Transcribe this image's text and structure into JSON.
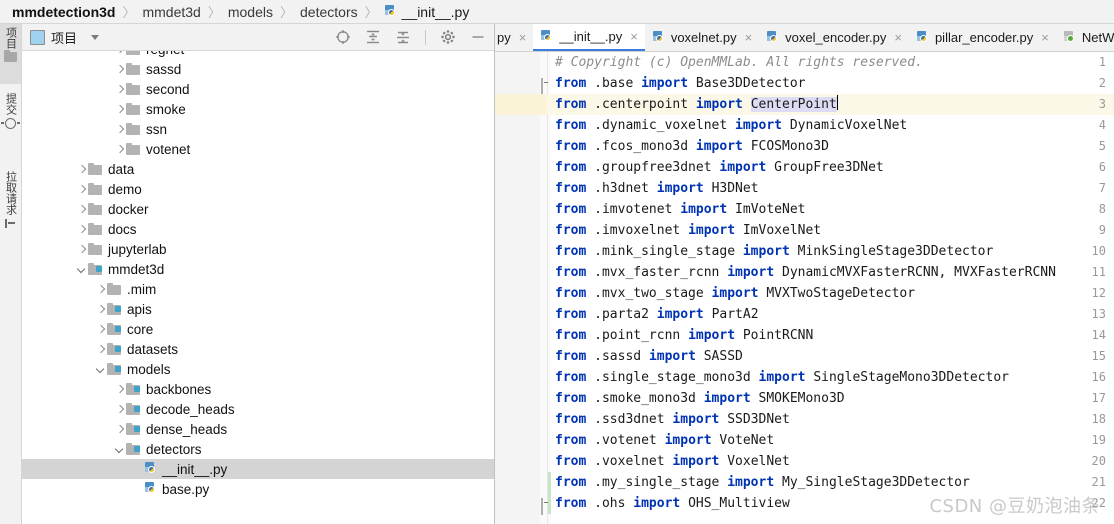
{
  "breadcrumb": {
    "items": [
      "mmdetection3d",
      "mmdet3d",
      "models",
      "detectors"
    ],
    "file": "__init__.py",
    "separator": "〉"
  },
  "toolstrip": {
    "items": [
      {
        "label": "项目",
        "icon": "folder-icon",
        "active": true
      },
      {
        "label": "提交",
        "icon": "commit-icon",
        "active": false
      },
      {
        "label": "拉取请求",
        "icon": "pull-request-icon",
        "active": false
      }
    ]
  },
  "project_panel": {
    "title": "项目",
    "tools": [
      {
        "name": "select-opened-file-icon",
        "label": "Select Opened File"
      },
      {
        "name": "expand-all-icon",
        "label": "Expand All"
      },
      {
        "name": "collapse-all-icon",
        "label": "Collapse All"
      },
      {
        "name": "settings-gear-icon",
        "label": "Settings"
      },
      {
        "name": "hide-panel-icon",
        "label": "Hide"
      }
    ],
    "tree": [
      {
        "label": "regnet",
        "depth": 3,
        "arrow": "right",
        "type": "folder",
        "selected": false
      },
      {
        "label": "sassd",
        "depth": 3,
        "arrow": "right",
        "type": "folder",
        "selected": false
      },
      {
        "label": "second",
        "depth": 3,
        "arrow": "right",
        "type": "folder",
        "selected": false
      },
      {
        "label": "smoke",
        "depth": 3,
        "arrow": "right",
        "type": "folder",
        "selected": false
      },
      {
        "label": "ssn",
        "depth": 3,
        "arrow": "right",
        "type": "folder",
        "selected": false
      },
      {
        "label": "votenet",
        "depth": 3,
        "arrow": "right",
        "type": "folder",
        "selected": false
      },
      {
        "label": "data",
        "depth": 1,
        "arrow": "right",
        "type": "folder",
        "selected": false
      },
      {
        "label": "demo",
        "depth": 1,
        "arrow": "right",
        "type": "folder",
        "selected": false
      },
      {
        "label": "docker",
        "depth": 1,
        "arrow": "right",
        "type": "folder",
        "selected": false
      },
      {
        "label": "docs",
        "depth": 1,
        "arrow": "right",
        "type": "folder",
        "selected": false
      },
      {
        "label": "jupyterlab",
        "depth": 1,
        "arrow": "right",
        "type": "folder",
        "selected": false
      },
      {
        "label": "mmdet3d",
        "depth": 1,
        "arrow": "down",
        "type": "folder-src",
        "selected": false
      },
      {
        "label": ".mim",
        "depth": 2,
        "arrow": "right",
        "type": "folder",
        "selected": false
      },
      {
        "label": "apis",
        "depth": 2,
        "arrow": "right",
        "type": "folder-src",
        "selected": false
      },
      {
        "label": "core",
        "depth": 2,
        "arrow": "right",
        "type": "folder-src",
        "selected": false
      },
      {
        "label": "datasets",
        "depth": 2,
        "arrow": "right",
        "type": "folder-src",
        "selected": false
      },
      {
        "label": "models",
        "depth": 2,
        "arrow": "down",
        "type": "folder-src",
        "selected": false
      },
      {
        "label": "backbones",
        "depth": 3,
        "arrow": "right",
        "type": "folder-src",
        "selected": false
      },
      {
        "label": "decode_heads",
        "depth": 3,
        "arrow": "right",
        "type": "folder-src",
        "selected": false
      },
      {
        "label": "dense_heads",
        "depth": 3,
        "arrow": "right",
        "type": "folder-src",
        "selected": false
      },
      {
        "label": "detectors",
        "depth": 3,
        "arrow": "down",
        "type": "folder-src",
        "selected": false
      },
      {
        "label": "__init__.py",
        "depth": 4,
        "arrow": "none",
        "type": "python",
        "selected": true
      },
      {
        "label": "base.py",
        "depth": 4,
        "arrow": "none",
        "type": "python",
        "selected": false
      }
    ]
  },
  "editor": {
    "tabs": [
      {
        "label": "py",
        "icon": "python-icon",
        "active": false,
        "clipped": true
      },
      {
        "label": "__init__.py",
        "icon": "python-icon",
        "active": true,
        "clipped": false
      },
      {
        "label": "voxelnet.py",
        "icon": "python-icon",
        "active": false,
        "clipped": false
      },
      {
        "label": "voxel_encoder.py",
        "icon": "python-icon",
        "active": false,
        "clipped": false
      },
      {
        "label": "pillar_encoder.py",
        "icon": "python-icon",
        "active": false,
        "clipped": false
      },
      {
        "label": "NetWo",
        "icon": "network-icon",
        "active": false,
        "clipped": true
      }
    ],
    "close_glyph": "×",
    "caret_line": 3,
    "selected_token": "CenterPoint",
    "lines": [
      {
        "n": 1,
        "comment": "# Copyright (c) OpenMMLab. All rights reserved."
      },
      {
        "n": 2,
        "module": ".base",
        "symbol": "Base3DDetector",
        "fold": "end"
      },
      {
        "n": 3,
        "module": ".centerpoint",
        "symbol": "CenterPoint",
        "highlight": true
      },
      {
        "n": 4,
        "module": ".dynamic_voxelnet",
        "symbol": "DynamicVoxelNet"
      },
      {
        "n": 5,
        "module": ".fcos_mono3d",
        "symbol": "FCOSMono3D"
      },
      {
        "n": 6,
        "module": ".groupfree3dnet",
        "symbol": "GroupFree3DNet"
      },
      {
        "n": 7,
        "module": ".h3dnet",
        "symbol": "H3DNet"
      },
      {
        "n": 8,
        "module": ".imvotenet",
        "symbol": "ImVoteNet"
      },
      {
        "n": 9,
        "module": ".imvoxelnet",
        "symbol": "ImVoxelNet"
      },
      {
        "n": 10,
        "module": ".mink_single_stage",
        "symbol": "MinkSingleStage3DDetector"
      },
      {
        "n": 11,
        "module": ".mvx_faster_rcnn",
        "symbol": "DynamicMVXFasterRCNN, MVXFasterRCNN"
      },
      {
        "n": 12,
        "module": ".mvx_two_stage",
        "symbol": "MVXTwoStageDetector"
      },
      {
        "n": 13,
        "module": ".parta2",
        "symbol": "PartA2"
      },
      {
        "n": 14,
        "module": ".point_rcnn",
        "symbol": "PointRCNN"
      },
      {
        "n": 15,
        "module": ".sassd",
        "symbol": "SASSD"
      },
      {
        "n": 16,
        "module": ".single_stage_mono3d",
        "symbol": "SingleStageMono3DDetector"
      },
      {
        "n": 17,
        "module": ".smoke_mono3d",
        "symbol": "SMOKEMono3D"
      },
      {
        "n": 18,
        "module": ".ssd3dnet",
        "symbol": "SSD3DNet"
      },
      {
        "n": 19,
        "module": ".votenet",
        "symbol": "VoteNet"
      },
      {
        "n": 20,
        "module": ".voxelnet",
        "symbol": "VoxelNet"
      },
      {
        "n": 21,
        "module": ".my_single_stage",
        "symbol": "My_SingleStage3DDetector",
        "added": true
      },
      {
        "n": 22,
        "module": ".ohs",
        "symbol": "OHS_Multiview",
        "added": true,
        "fold": "end"
      }
    ],
    "keywords": {
      "from": "from",
      "import": "import"
    }
  },
  "annotation": {
    "type": "red-arrow",
    "direction": "left",
    "color": "#e01b1b"
  },
  "watermark": {
    "text": "CSDN @豆奶泡油条"
  }
}
